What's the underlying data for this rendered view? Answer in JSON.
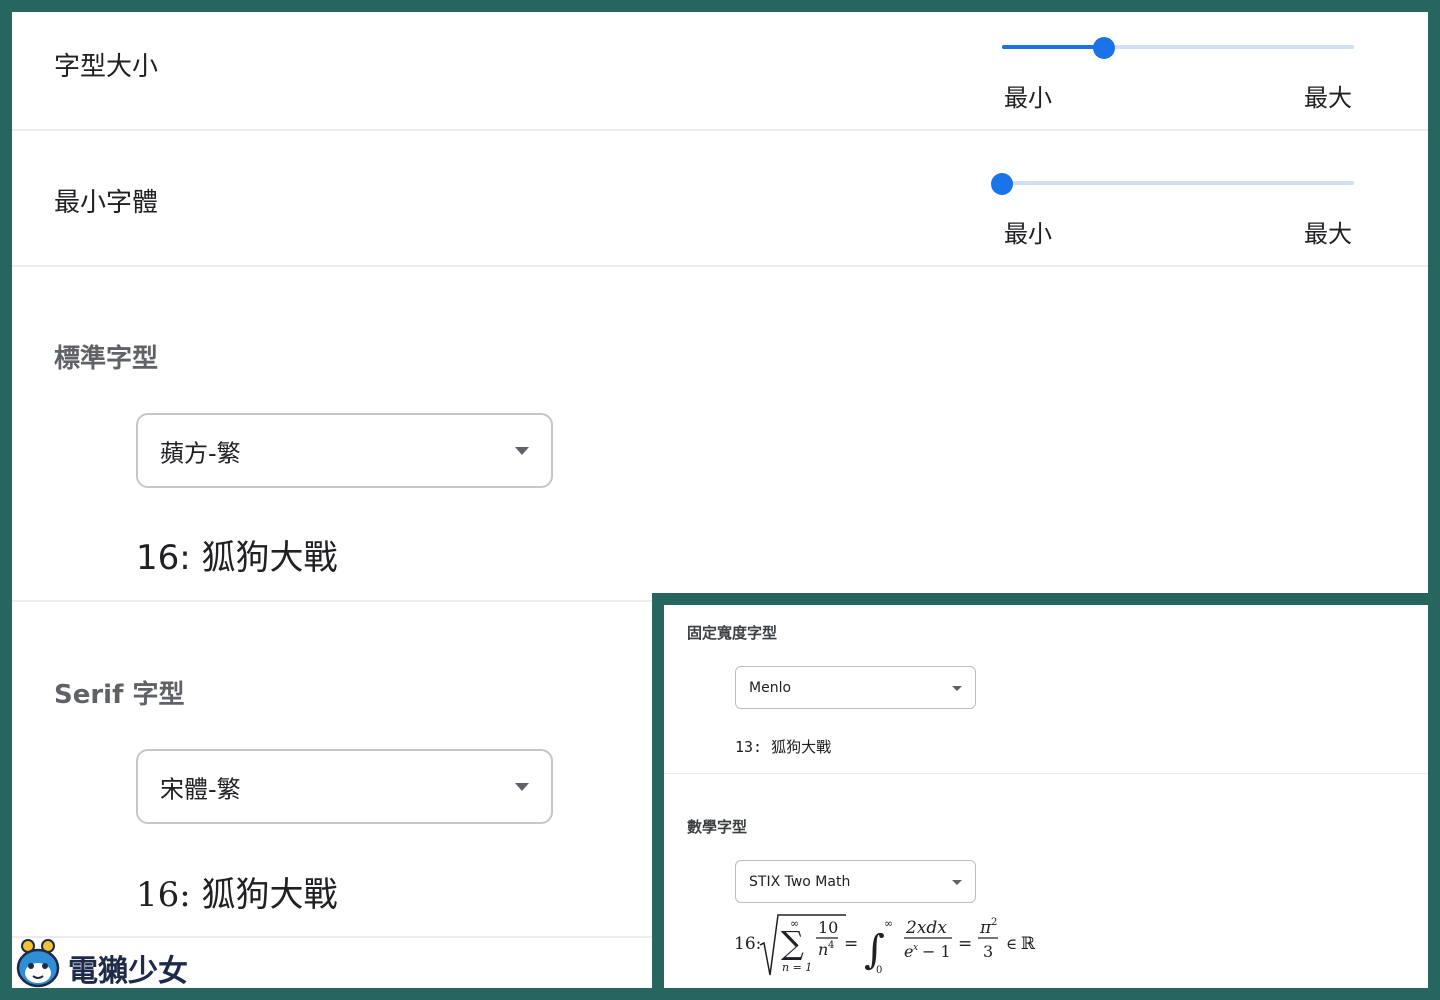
{
  "font_size": {
    "label": "字型大小",
    "min_label": "最小",
    "max_label": "最大",
    "level": 0.29
  },
  "minimum_font": {
    "label": "最小字體",
    "min_label": "最小",
    "max_label": "最大",
    "level": 0
  },
  "standard_font": {
    "heading": "標準字型",
    "selected": "蘋方-繁",
    "preview": "16: 狐狗大戰"
  },
  "serif_font": {
    "heading": "Serif 字型",
    "selected": "宋體-繁",
    "preview": "16: 狐狗大戰"
  },
  "fixed_width_font": {
    "heading": "固定寬度字型",
    "selected": "Menlo",
    "preview": "13: 狐狗大戰"
  },
  "math_font": {
    "heading": "數學字型",
    "selected": "STIX Two Math",
    "preview_prefix": "16:"
  },
  "watermark": {
    "text": "電獺少女"
  },
  "colors": {
    "frame": "#27655f",
    "accent": "#1a73e8",
    "track": "#cfe0f5"
  }
}
